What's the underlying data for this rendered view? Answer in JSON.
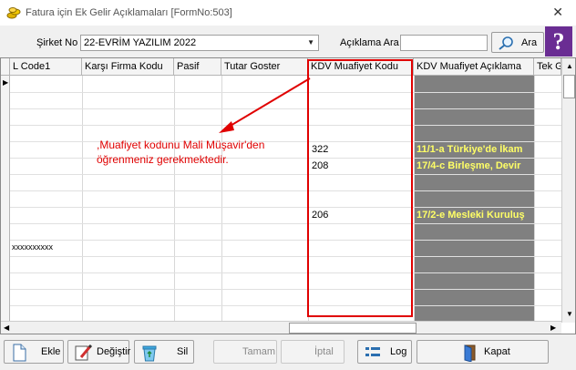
{
  "window": {
    "title": "Fatura için Ek Gelir Açıklamaları [FormNo:503]",
    "close_glyph": "✕"
  },
  "filters": {
    "company_label": "Şirket No",
    "company_value": "22-EVRİM YAZILIM  2022",
    "desc_label": "Açıklama Ara",
    "desc_value": "",
    "search_button": "Ara",
    "help_glyph": "?"
  },
  "grid": {
    "columns": [
      "L Code1",
      "Karşı Firma Kodu",
      "Pasif",
      "Tutar Goster",
      "KDV Muafiyet Kodu",
      "KDV Muafiyet Açıklama",
      "Tek G"
    ],
    "rows": [
      {
        "lcode": "",
        "muaf_kodu": "",
        "aciklama": ""
      },
      {
        "lcode": "",
        "muaf_kodu": "",
        "aciklama": ""
      },
      {
        "lcode": "",
        "muaf_kodu": "",
        "aciklama": ""
      },
      {
        "lcode": "",
        "muaf_kodu": "",
        "aciklama": ""
      },
      {
        "lcode": "",
        "muaf_kodu": "322",
        "aciklama": "11/1-a Türkiye'de İkam"
      },
      {
        "lcode": "",
        "muaf_kodu": "208",
        "aciklama": "17/4-c Birleşme, Devir"
      },
      {
        "lcode": "",
        "muaf_kodu": "",
        "aciklama": ""
      },
      {
        "lcode": "",
        "muaf_kodu": "",
        "aciklama": ""
      },
      {
        "lcode": "",
        "muaf_kodu": "206",
        "aciklama": "17/2-e Mesleki Kuruluş"
      },
      {
        "lcode": "",
        "muaf_kodu": "",
        "aciklama": ""
      },
      {
        "lcode": "xxxxxxxxxx",
        "muaf_kodu": "",
        "aciklama": ""
      }
    ]
  },
  "annotation": {
    "line1": ",Muafiyet kodunu Mali Müşavir'den",
    "line2": "öğrenmeniz gerekmektedir.",
    "color": "#e00000"
  },
  "toolbar": {
    "add": "Ekle",
    "edit": "Değiştir",
    "delete": "Sil",
    "ok": "Tamam",
    "cancel": "İptal",
    "log": "Log",
    "close": "Kapat"
  }
}
